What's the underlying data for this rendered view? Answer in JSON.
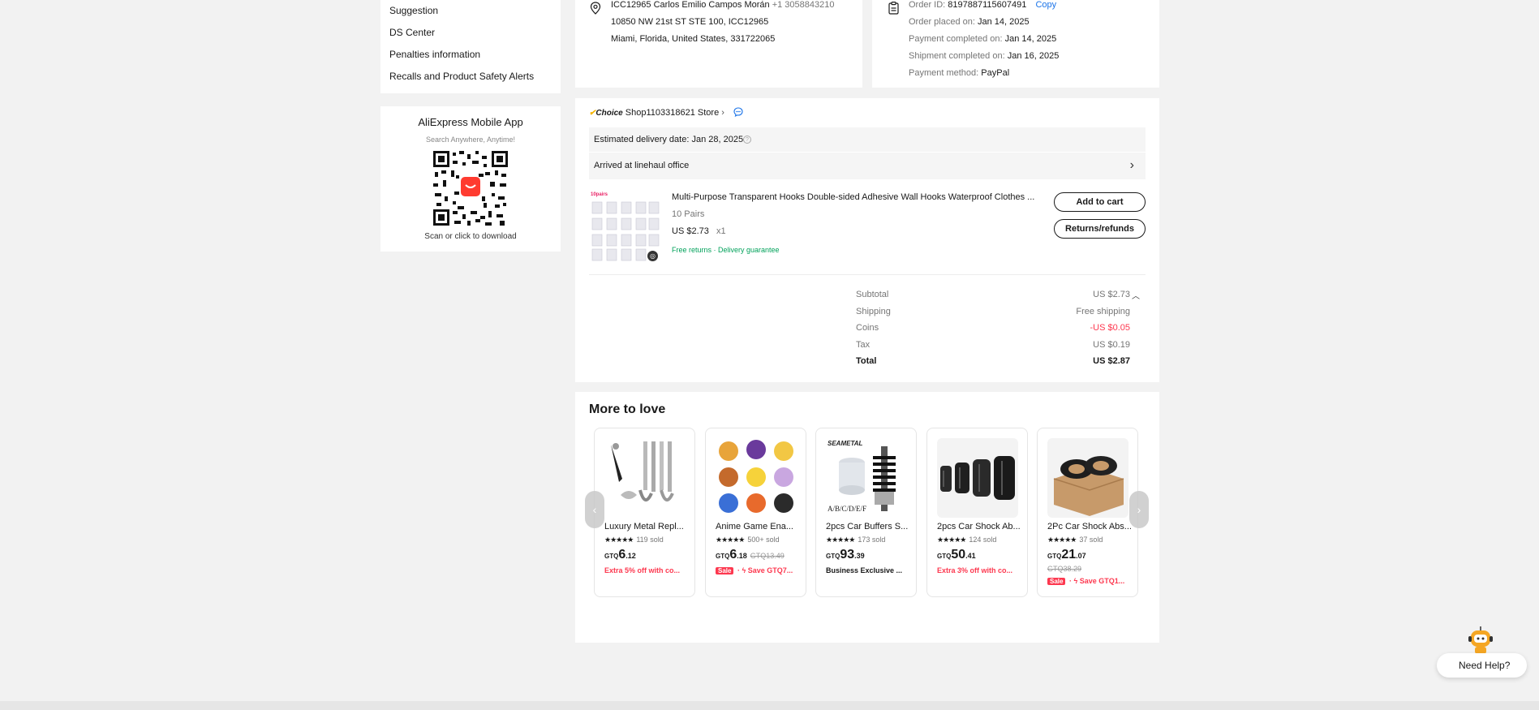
{
  "sidebar": {
    "links": [
      "Suggestion",
      "DS Center",
      "Penalties information",
      "Recalls and Product Safety Alerts"
    ],
    "app": {
      "title": "AliExpress Mobile App",
      "subtitle": "Search Anywhere, Anytime!",
      "caption": "Scan or click to download"
    }
  },
  "address": {
    "name": "ICC12965 Carlos Emilio Campos Morán",
    "phone": "+1 3058843210",
    "line1": "10850 NW 21st ST STE 100, ICC12965",
    "line2": "Miami, Florida, United States, 331722065"
  },
  "order": {
    "id_label": "Order ID:",
    "id": "8197887115607491",
    "copy_label": "Copy",
    "placed_label": "Order placed on:",
    "placed": "Jan 14, 2025",
    "paid_label": "Payment completed on:",
    "paid": "Jan 14, 2025",
    "shipped_label": "Shipment completed on:",
    "shipped": "Jan 16, 2025",
    "method_label": "Payment method:",
    "method": "PayPal"
  },
  "store": {
    "choice_label": "Choice",
    "name": "Shop1103318621 Store",
    "delivery": "Estimated delivery date: Jan 28, 2025",
    "tracking_status": "Arrived at linehaul office",
    "item": {
      "title": "Multi-Purpose Transparent Hooks Double-sided Adhesive Wall Hooks Waterproof Clothes ...",
      "variant": "10 Pairs",
      "price": "US $2.73",
      "qty": "x1",
      "tags": "Free returns · Delivery guarantee",
      "thumb_label": "10pairs"
    },
    "buttons": {
      "add_to_cart": "Add to cart",
      "returns": "Returns/refunds"
    },
    "summary": [
      {
        "label": "Subtotal",
        "value": "US $2.73"
      },
      {
        "label": "Shipping",
        "value": "Free shipping"
      },
      {
        "label": "Coins",
        "value": "-US $0.05"
      },
      {
        "label": "Tax",
        "value": "US $0.19"
      },
      {
        "label": "Total",
        "value": "US $2.87"
      }
    ]
  },
  "more": {
    "title": "More to love",
    "products": [
      {
        "name": "Luxury Metal Repl...",
        "stars": "★★★★★",
        "sold": "119 sold",
        "cur": "GTQ",
        "int": "6",
        "dec": ".12",
        "old": "",
        "promo": "Extra 5% off with co...",
        "sale": ""
      },
      {
        "name": "Anime Game Ena...",
        "stars": "★★★★★",
        "sold": "500+ sold",
        "cur": "GTQ",
        "int": "6",
        "dec": ".18",
        "old": "GTQ13.49",
        "promo": "Save GTQ7...",
        "sale": "Sale"
      },
      {
        "name": "2pcs Car Buffers S...",
        "stars": "★★★★★",
        "sold": "173 sold",
        "cur": "GTQ",
        "int": "93",
        "dec": ".39",
        "old": "",
        "promo": "Business Exclusive ...",
        "sale": ""
      },
      {
        "name": "2pcs Car Shock Ab...",
        "stars": "★★★★★",
        "sold": "124 sold",
        "cur": "GTQ",
        "int": "50",
        "dec": ".41",
        "old": "",
        "promo": "Extra 3% off with co...",
        "sale": ""
      },
      {
        "name": "2Pc Car Shock Abs...",
        "stars": "★★★★★",
        "sold": "37 sold",
        "cur": "GTQ",
        "int": "21",
        "dec": ".07",
        "old": "GTQ38.29",
        "promo": "Save GTQ1...",
        "sale": "Sale"
      }
    ]
  },
  "help": {
    "label": "Need Help?"
  },
  "colors": {
    "accent_red": "#fd384f",
    "link_blue": "#1a73e8",
    "green": "#00a15a"
  }
}
